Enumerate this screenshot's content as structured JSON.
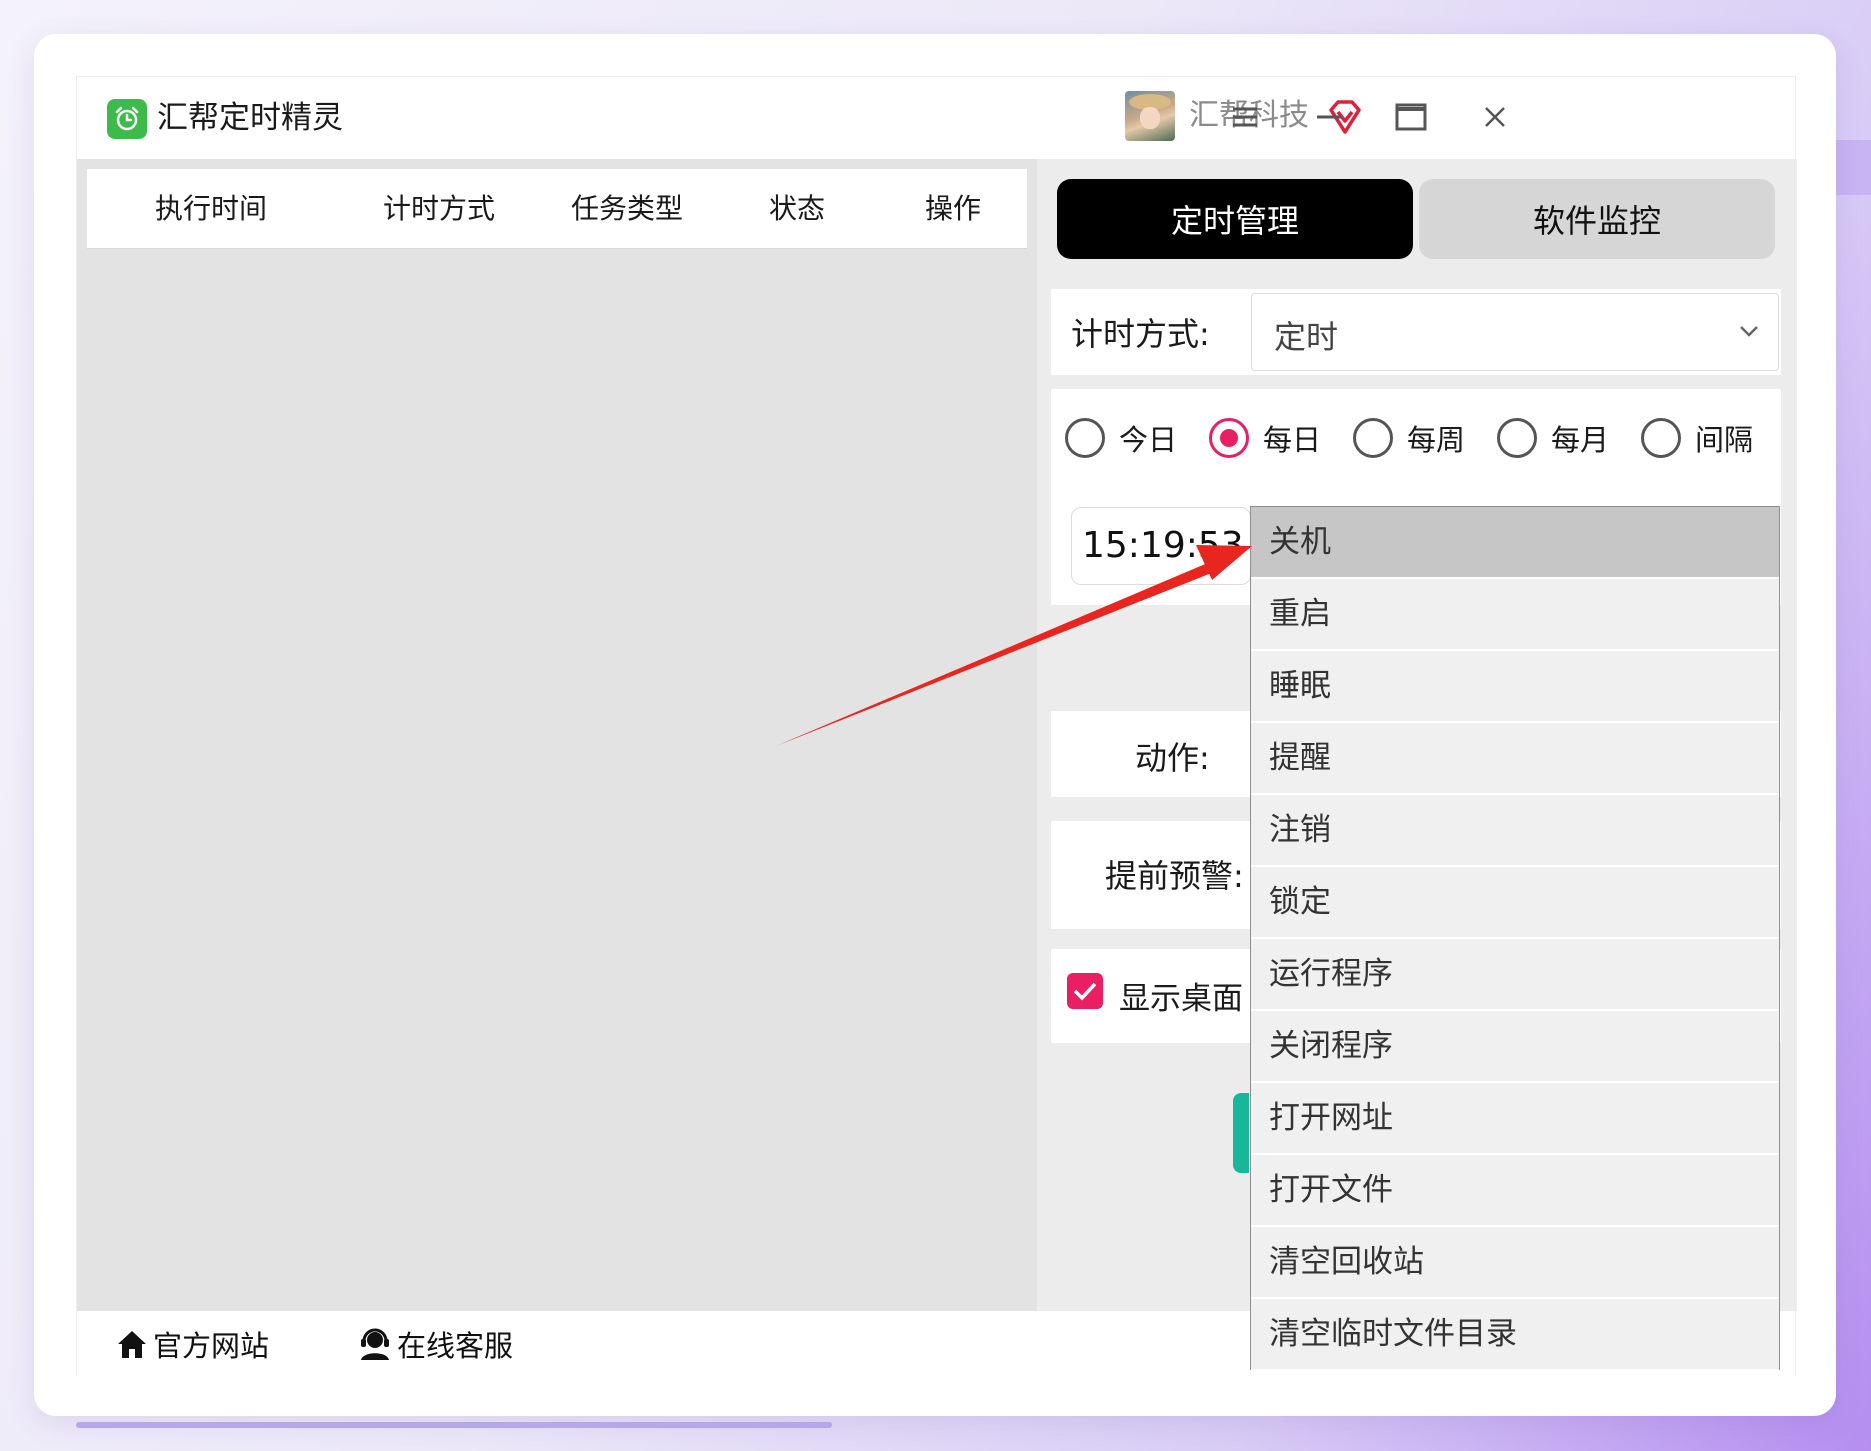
{
  "window": {
    "app_title": "汇帮定时精灵",
    "company_name": "汇帮科技",
    "icons": [
      "alarm-clock-icon",
      "vip-diamond-icon",
      "menu-icon",
      "minimize-icon",
      "maximize-icon",
      "close-icon"
    ]
  },
  "task_table": {
    "columns": [
      "执行时间",
      "计时方式",
      "任务类型",
      "状态",
      "操作"
    ]
  },
  "tabs": [
    {
      "label": "定时管理",
      "active": true
    },
    {
      "label": "软件监控",
      "active": false
    }
  ],
  "form": {
    "timing_mode_label": "计时方式:",
    "timing_mode_value": "定时",
    "frequency_options": [
      {
        "label": "今日",
        "checked": false
      },
      {
        "label": "每日",
        "checked": true
      },
      {
        "label": "每周",
        "checked": false
      },
      {
        "label": "每月",
        "checked": false
      },
      {
        "label": "间隔",
        "checked": false
      }
    ],
    "time_value": "15:19:53",
    "action_label": "动作:",
    "warning_label": "提前预警:",
    "desktop_checkbox_label": "显示桌面",
    "desktop_checkbox_checked": true
  },
  "action_dropdown": {
    "highlighted_index": 0,
    "options": [
      "关机",
      "重启",
      "睡眠",
      "提醒",
      "注销",
      "锁定",
      "运行程序",
      "关闭程序",
      "打开网址",
      "打开文件",
      "清空回收站",
      "清空临时文件目录"
    ]
  },
  "footer": {
    "website_label": "官方网站",
    "support_label": "在线客服"
  },
  "colors": {
    "accent_pink": "#e91e63",
    "tab_active": "#000000",
    "annotation_arrow": "#e8251f",
    "app_icon_green": "#3dbb4a"
  }
}
